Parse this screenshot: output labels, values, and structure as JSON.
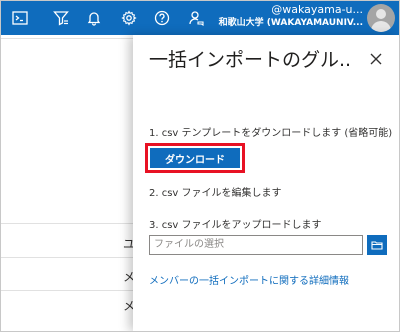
{
  "topbar": {
    "icons": [
      "cloud-shell-icon",
      "directory-filter-icon",
      "notifications-icon",
      "settings-icon",
      "help-icon",
      "feedback-icon"
    ],
    "account_name": "@wakayama-u...",
    "account_org": "和歌山大学 (WAKAYAMAUNIV..."
  },
  "background": {
    "row_texts": [
      "ユ",
      "メ",
      "メ"
    ]
  },
  "panel": {
    "title": "一括インポートのグル...",
    "step1": "1. csv テンプレートをダウンロードします (省略可能)",
    "download_label": "ダウンロード",
    "step2": "2. csv ファイルを編集します",
    "step3": "3. csv ファイルをアップロードします",
    "file_placeholder": "ファイルの選択",
    "info_link": "メンバーの一括インポートに関する詳細情報"
  },
  "colors": {
    "accent": "#0f6cbd",
    "highlight": "#e81123"
  }
}
